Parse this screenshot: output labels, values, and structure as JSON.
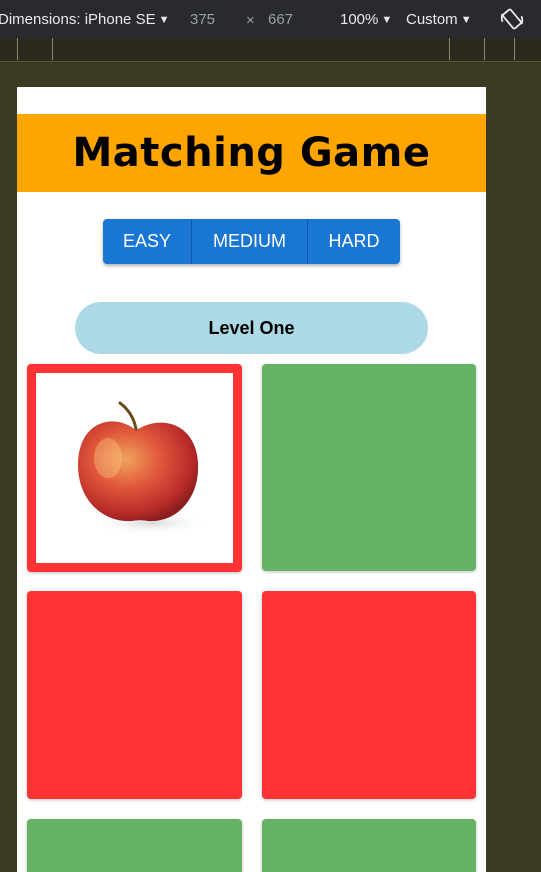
{
  "devtools": {
    "dimensions_label": "Dimensions: iPhone SE",
    "width": "375",
    "times": "×",
    "height": "667",
    "zoom": "100%",
    "throttle": "Custom"
  },
  "game": {
    "title": "Matching Game",
    "difficulty": [
      "EASY",
      "MEDIUM",
      "HARD"
    ],
    "level": "Level One"
  },
  "cards": [
    {
      "state": "revealed",
      "image": "apple",
      "color": "#ff3333"
    },
    {
      "state": "hidden",
      "color": "#66b266"
    },
    {
      "state": "hidden",
      "color": "#ff3333"
    },
    {
      "state": "hidden",
      "color": "#ff3333"
    },
    {
      "state": "hidden",
      "color": "#66b266"
    },
    {
      "state": "hidden",
      "color": "#66b266"
    }
  ],
  "colors": {
    "header": "#ffa500",
    "button": "#1976d2",
    "level_pill": "#add8e6"
  }
}
